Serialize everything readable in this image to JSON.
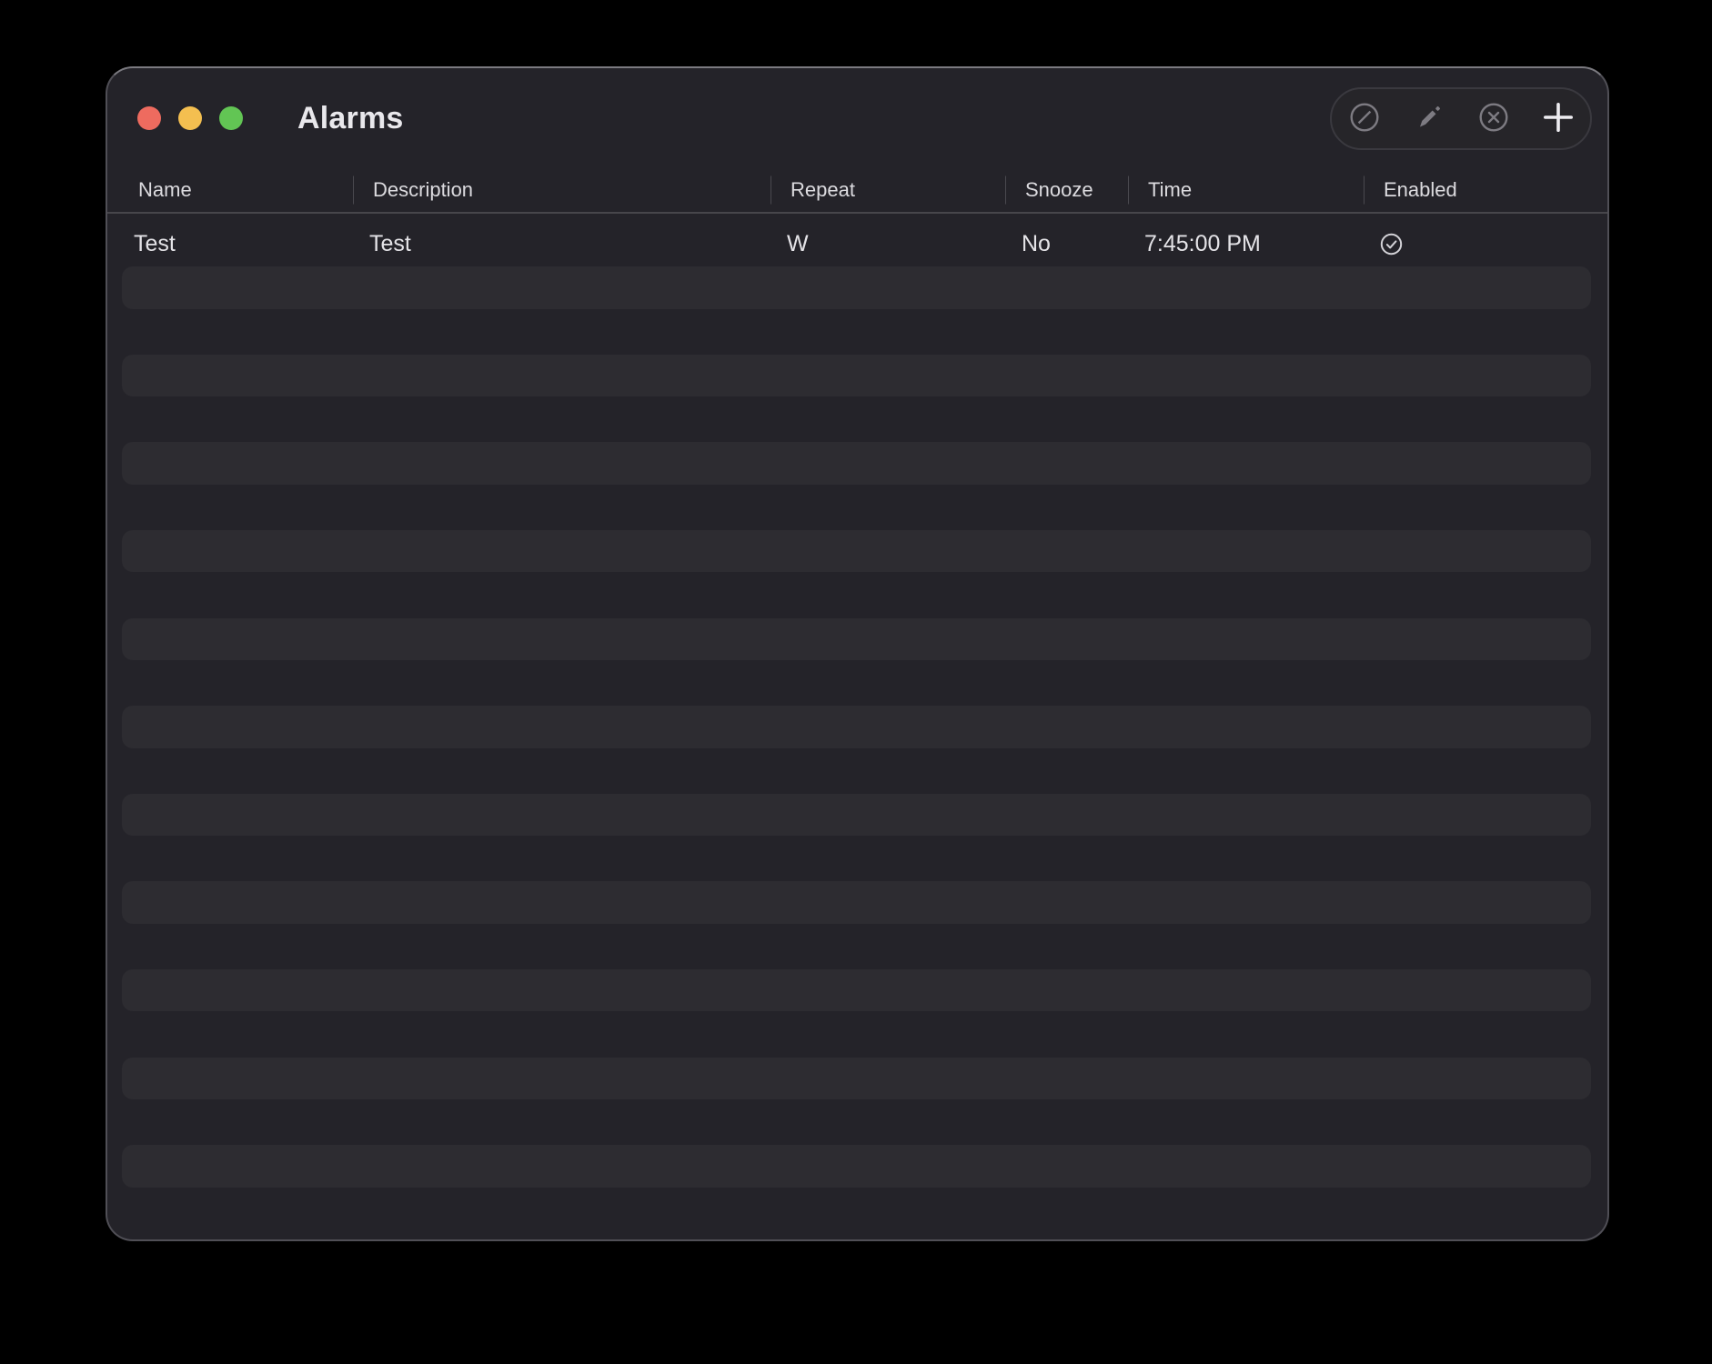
{
  "window": {
    "title": "Alarms"
  },
  "titlebar": {
    "traffic_lights": [
      {
        "name": "close",
        "color": "#ee6b5f"
      },
      {
        "name": "minimize",
        "color": "#f4bf50"
      },
      {
        "name": "zoom",
        "color": "#62c554"
      }
    ]
  },
  "toolbar": {
    "buttons": [
      {
        "name": "disable-alarm",
        "icon": "circle-slash-icon"
      },
      {
        "name": "edit-alarm",
        "icon": "pencil-icon"
      },
      {
        "name": "remove-alarm",
        "icon": "circle-x-icon"
      },
      {
        "name": "add-alarm",
        "icon": "plus-icon"
      }
    ]
  },
  "table": {
    "columns": [
      "Name",
      "Description",
      "Repeat",
      "Snooze",
      "Time",
      "Enabled"
    ],
    "column_keys": [
      "name",
      "description",
      "repeat",
      "snooze",
      "time",
      "enabled"
    ],
    "rows": [
      {
        "name": "Test",
        "description": "Test",
        "repeat": "W",
        "snooze": "No",
        "time": "7:45:00 PM",
        "enabled": true,
        "enabled_icon": "check-circle-icon"
      }
    ],
    "empty_row_count": 22
  },
  "colors": {
    "window_bg": "#242329",
    "row_alt_bg": "#2d2c31",
    "header_text": "#dcdbdf",
    "cell_text": "#e4e3e7",
    "icon_gray": "#7d7b82",
    "icon_bright": "#eeedf1",
    "check_icon": "#d4d3d8"
  }
}
